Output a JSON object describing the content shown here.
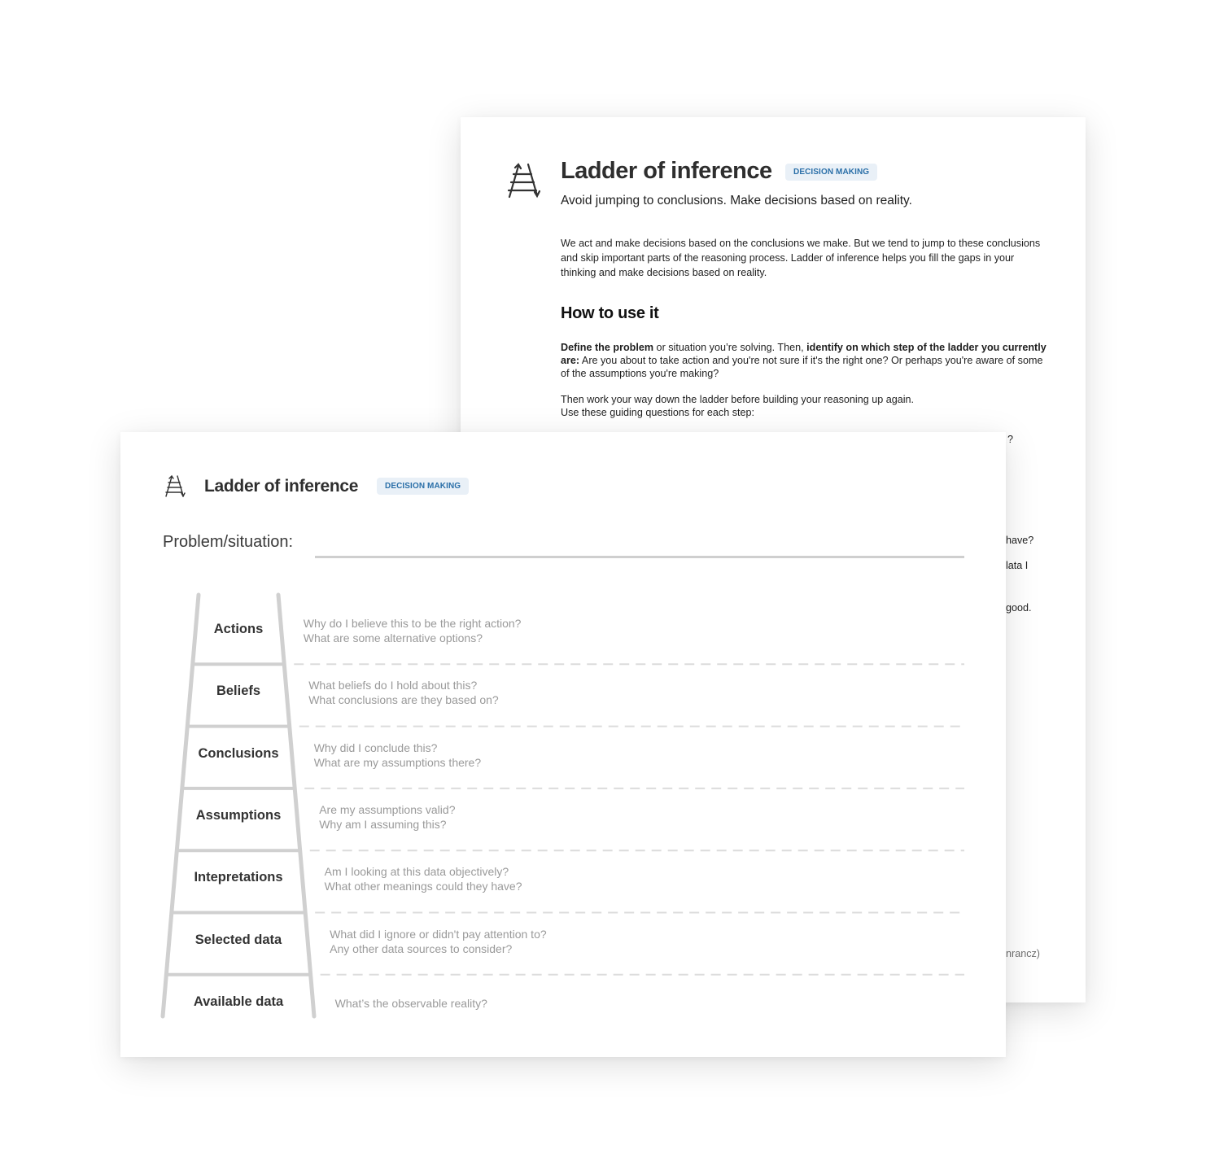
{
  "back_page": {
    "icon": "ladder-icon",
    "title": "Ladder of inference",
    "badge": "DECISION MAKING",
    "subtitle": "Avoid jumping to conclusions. Make decisions based on reality.",
    "intro": "We act and make decisions based on the conclusions we make. But we tend to jump to these conclusions and skip important parts of the reasoning process. Ladder of inference helps you fill the gaps in your thinking and make decisions based on reality.",
    "how_to_heading": "How to use it",
    "para1": {
      "bold1": "Define the problem",
      "text1": " or situation you’re solving. Then, ",
      "bold2": "identify on which step of the ladder you currently are:",
      "text2": " Are you about to take action and you're not sure if it's the right one? Or perhaps you're aware of some of the assumptions you're making?"
    },
    "para2_line1": "Then work your way down the ladder before building your reasoning up again.",
    "para2_line2": "Use these guiding questions for each step:",
    "partial_fragments": [
      "?",
      "have?",
      "lata I",
      "good.",
      "nrancz)"
    ]
  },
  "front_page": {
    "icon": "ladder-icon",
    "title": "Ladder of inference",
    "badge": "DECISION MAKING",
    "problem_label": "Problem/situation:",
    "problem_value": "",
    "steps": [
      {
        "label": "Actions",
        "q1": "Why do I believe this to be the right action?",
        "q2": "What are some alternative options?"
      },
      {
        "label": "Beliefs",
        "q1": "What beliefs do I hold about this?",
        "q2": "What conclusions are they based on?"
      },
      {
        "label": "Conclusions",
        "q1": "Why did I conclude this?",
        "q2": "What are my assumptions there?"
      },
      {
        "label": "Assumptions",
        "q1": "Are my assumptions valid?",
        "q2": "Why am I assuming this?"
      },
      {
        "label": "Intepretations",
        "q1": "Am I looking at this data objectively?",
        "q2": "What other meanings could they have?"
      },
      {
        "label": "Selected data",
        "q1": "What did I ignore or didn't pay attention to?",
        "q2": "Any other data sources to consider?"
      },
      {
        "label": "Available data",
        "q1": "What’s the observable reality?",
        "q2": ""
      }
    ]
  },
  "colors": {
    "badge_bg": "#e9f0f7",
    "badge_text": "#2a6fa8",
    "ladder_gray": "#d0d0d0",
    "question_gray": "#9a9a9a",
    "dashed_line": "#dcdcdc"
  }
}
